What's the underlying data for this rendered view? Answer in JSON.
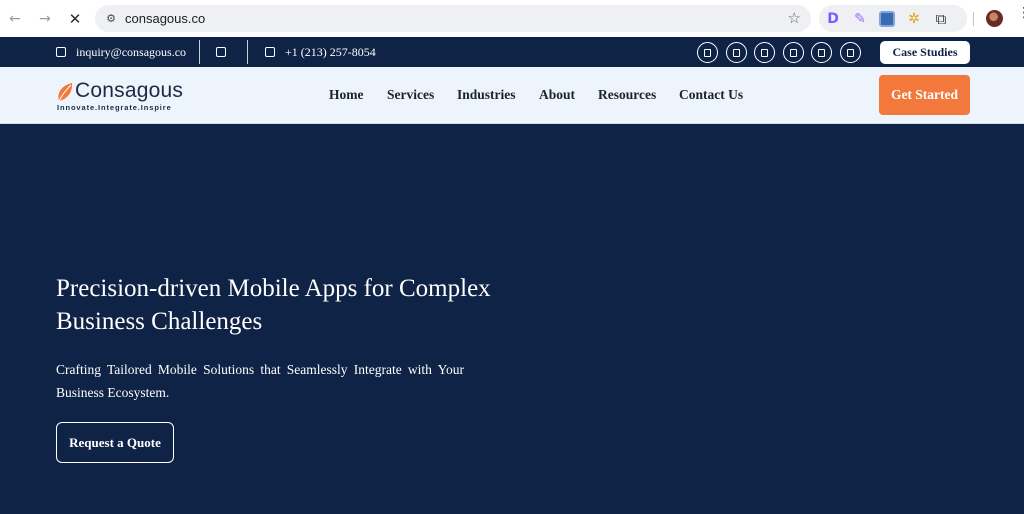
{
  "browser": {
    "url": "consagous.co",
    "back_icon": "←",
    "forward_icon": "→",
    "stop_icon": "✕",
    "tune_icon": "⚙",
    "star_icon": "☆",
    "extensions": [
      {
        "name": "d-extension-icon",
        "glyph": "D"
      },
      {
        "name": "pen-extension-icon",
        "glyph": "✎"
      },
      {
        "name": "square-extension-icon",
        "glyph": ""
      },
      {
        "name": "bug-extension-icon",
        "glyph": "✲"
      },
      {
        "name": "puzzle-extensions-icon",
        "glyph": "⧉"
      }
    ],
    "menu_icon": "⋮"
  },
  "topbar": {
    "email": "inquiry@consagous.co",
    "phone": "+1 (213) 257-8054",
    "social_icons": [
      "social-icon-1",
      "social-icon-2",
      "social-icon-3",
      "social-icon-4",
      "social-icon-5",
      "social-icon-6"
    ],
    "case_studies": "Case Studies"
  },
  "header": {
    "logo_word": "Consagous",
    "logo_tagline": "Innovate.Integrate.Inspire",
    "nav": [
      "Home",
      "Services",
      "Industries",
      "About",
      "Resources",
      "Contact Us"
    ],
    "cta": "Get Started"
  },
  "hero": {
    "title": "Precision-driven Mobile Apps for Complex Business Challenges",
    "subtitle": "Crafting Tailored Mobile Solutions that Seamlessly Integrate with Your Business Ecosystem.",
    "button": "Request a Quote"
  },
  "colors": {
    "navy": "#0f2347",
    "header_bg": "#eef4fc",
    "accent_orange": "#f2783c"
  }
}
